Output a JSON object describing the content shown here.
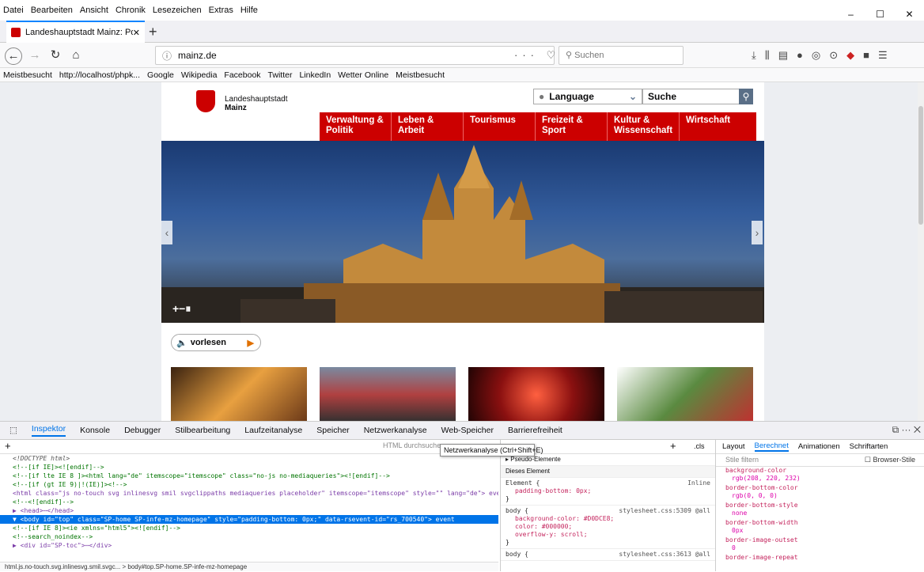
{
  "menubar": [
    "Datei",
    "Bearbeiten",
    "Ansicht",
    "Chronik",
    "Lesezeichen",
    "Extras",
    "Hilfe"
  ],
  "window_controls": [
    "–",
    "☐",
    "✕"
  ],
  "tab": {
    "title": "Landeshauptstadt Mainz: Porta",
    "close": "✕",
    "new": "+"
  },
  "nav": {
    "url": "mainz.de",
    "search_placeholder": "Suchen",
    "url_actions": "··· ♡ ☆"
  },
  "bookmarks": [
    "Meistbesucht",
    "http://localhost/phpk...",
    "Google",
    "Wikipedia",
    "Facebook",
    "Twitter",
    "LinkedIn",
    "Wetter Online",
    "Meistbesucht"
  ],
  "site": {
    "logo_line1": "Landeshauptstadt",
    "logo_line2": "Mainz",
    "language": "Language",
    "search": "Suche",
    "nav": [
      "Verwaltung & Politik",
      "Leben & Arbeit",
      "Tourismus",
      "Freizeit & Sport",
      "Kultur & Wissenschaft",
      "Wirtschaft"
    ],
    "hero_controls": "+−⏸",
    "vorlesen": "vorlesen"
  },
  "devtools": {
    "tabs": [
      "Inspektor",
      "Konsole",
      "Debugger",
      "Stilbearbeitung",
      "Laufzeitanalyse",
      "Speicher",
      "Netzwerkanalyse",
      "Web-Speicher",
      "Barrierefreiheit"
    ],
    "active_tab": "Inspektor",
    "html_search": "HTML durchsuchen",
    "tooltip": "Netzwerkanalyse (Ctrl+Shift+E)",
    "markup": [
      "<!DOCTYPE html>",
      "<!--[if IE]><![endif]-->",
      "<!--[if lte IE 8 ]><html lang=\"de\" itemscope=\"itemscope\" class=\"no-js no-mediaqueries\"><![endif]-->",
      "<!--[if (gt IE 9)|!(IE)]><!-->",
      "<html class=\"js no-touch svg inlinesvg smil svgclippaths mediaqueries placeholder\" itemscope=\"itemscope\" style=\"\" lang=\"de\"> event",
      "  <!--<![endif]-->",
      "▶ <head>⋯</head>",
      "▼ <body id=\"top\" class=\"SP-home SP-infe-mz-homepage\" style=\"padding-bottom: 0px;\" data-rsevent-id=\"rs_700540\"> event",
      "    <!--[if IE 8]><ie xmlns=\"html5\"><![endif]-->",
      "    <!--search_noindex-->",
      "  ▶ <div id=\"SP-toc\">⋯</div>"
    ],
    "breadcrumbs": "html.js.no-touch.svg.inlinesvg.smil.svgc... > body#top.SP-home.SP-infe-mz-homepage",
    "rules": {
      "pseudo": "Pseudo-Elemente",
      "this_element": "Dieses Element",
      "r1_sel": "Element { ",
      "r1_src": "Inline",
      "r1_props": [
        "padding-bottom: 0px;"
      ],
      "r2_sel": "body { ",
      "r2_src": "stylesheet.css:5309 @all",
      "r2_props": [
        "background-color: #D0DCE8;",
        "color: #000000;",
        "overflow-y: scroll;"
      ],
      "r3_sel": "body { ",
      "r3_src": "stylesheet.css:3613 @all"
    },
    "computed": {
      "tabs": [
        "Layout",
        "Berechnet",
        "Animationen",
        "Schriftarten"
      ],
      "active": "Berechnet",
      "filter": "Stile filtern",
      "browser_styles": "Browser-Stile",
      "props": [
        {
          "name": "background-color",
          "value": "rgb(208, 220, 232)"
        },
        {
          "name": "border-bottom-color",
          "value": "rgb(0, 0, 0)"
        },
        {
          "name": "border-bottom-style",
          "value": "none"
        },
        {
          "name": "border-bottom-width",
          "value": "0px"
        },
        {
          "name": "border-image-outset",
          "value": "0"
        },
        {
          "name": "border-image-repeat",
          "value": ""
        }
      ]
    }
  }
}
